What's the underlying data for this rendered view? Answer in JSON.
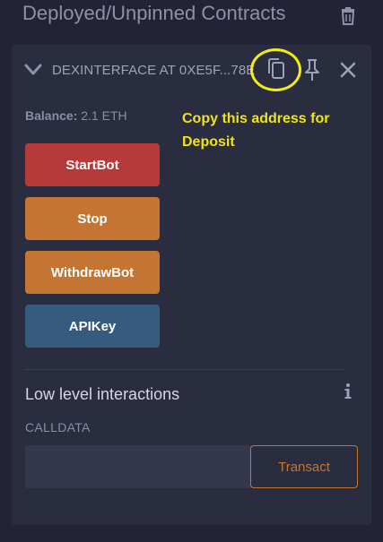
{
  "header": {
    "title": "Deployed/Unpinned Contracts",
    "trash_icon": "trash-icon"
  },
  "contract": {
    "label": "DEXINTERFACE AT 0XE5F...78E",
    "expand_icon": "chevron-down-icon",
    "copy_icon": "copy-icon",
    "pin_icon": "pin-icon",
    "close_icon": "close-icon",
    "balance_label": "Balance:",
    "balance_value": "2.1 ETH"
  },
  "annotation": {
    "text": "Copy this address for Deposit",
    "color": "#f1e515"
  },
  "actions": [
    {
      "label": "StartBot",
      "color": "#b63a3a"
    },
    {
      "label": "Stop",
      "color": "#c57533"
    },
    {
      "label": "WithdrawBot",
      "color": "#c57533"
    },
    {
      "label": "APIKey",
      "color": "#375a7f"
    }
  ],
  "low_level": {
    "title": "Low level interactions",
    "info_icon": "info-icon",
    "calldata_label": "CALLDATA",
    "calldata_value": "",
    "transact_label": "Transact"
  }
}
